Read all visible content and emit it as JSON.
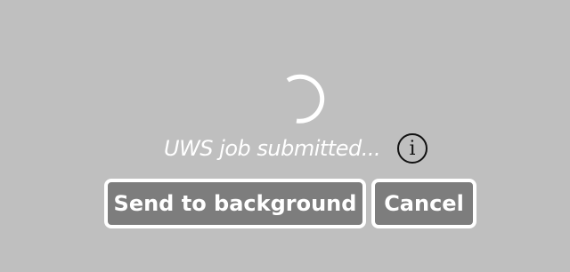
{
  "status": {
    "message": "UWS job submitted...",
    "info_icon_glyph": "i",
    "info_icon": "info-icon"
  },
  "buttons": {
    "send_to_background": "Send to background",
    "cancel": "Cancel"
  },
  "colors": {
    "backdrop": "#bfbfbf",
    "button_fill": "#7d7d7d",
    "button_border": "#ffffff",
    "text": "#ffffff",
    "spinner": "#ffffff"
  }
}
